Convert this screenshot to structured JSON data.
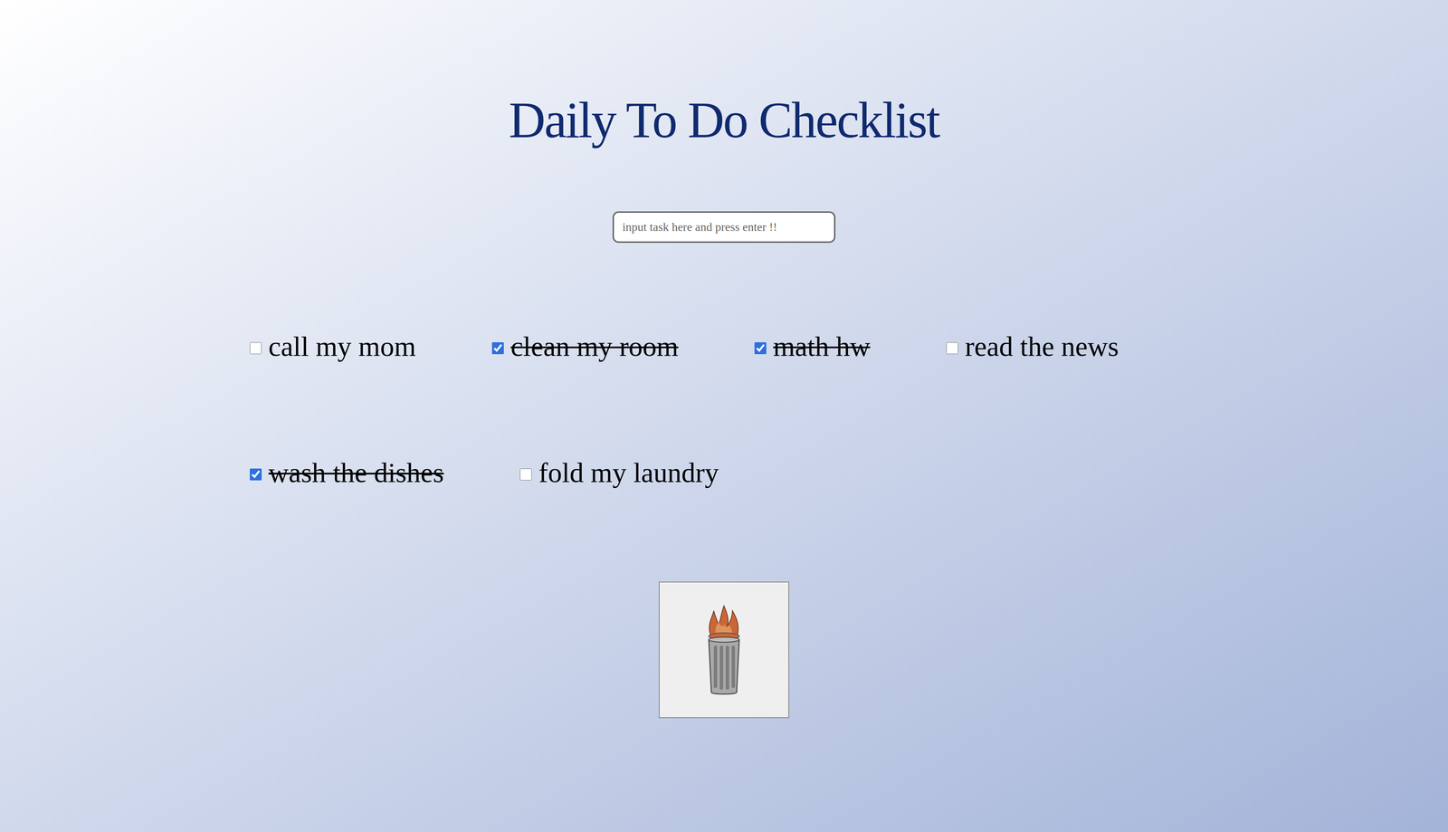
{
  "title": "Daily To Do Checklist",
  "input": {
    "placeholder": "input task here and press enter !!",
    "value": ""
  },
  "tasks": [
    {
      "label": "call my mom",
      "checked": false
    },
    {
      "label": "clean my room",
      "checked": true
    },
    {
      "label": "math hw",
      "checked": true
    },
    {
      "label": "read the news",
      "checked": false
    },
    {
      "label": "wash the dishes",
      "checked": true
    },
    {
      "label": "fold my laundry",
      "checked": false
    }
  ]
}
